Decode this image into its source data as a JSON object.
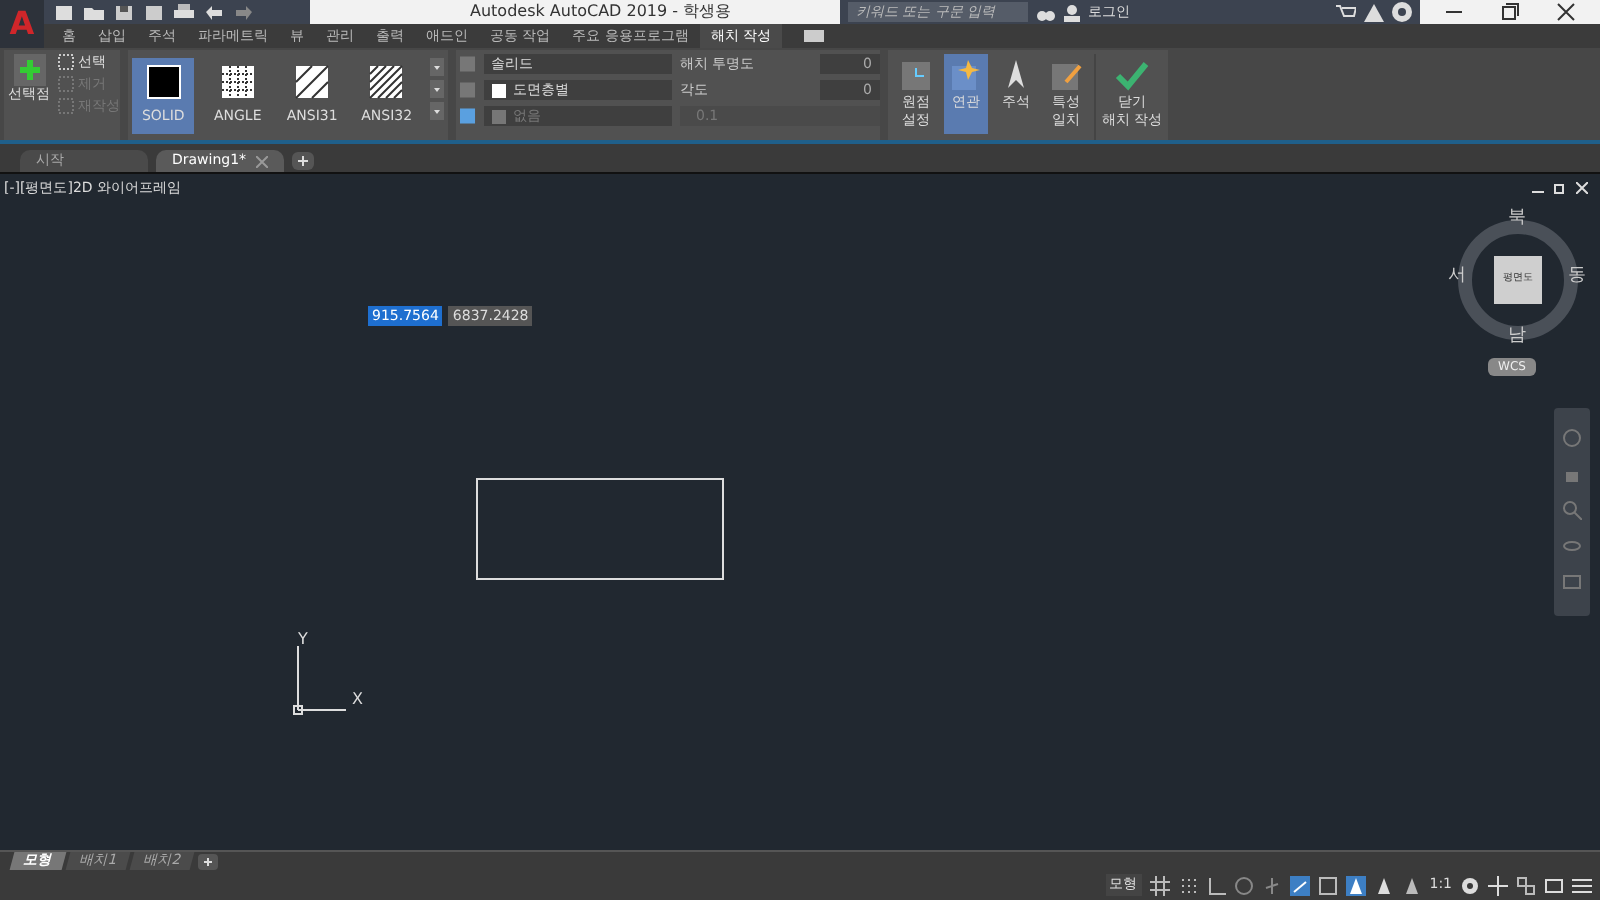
{
  "title_bar": {
    "app_button": "A",
    "title": "Autodesk AutoCAD 2019 - 학생용",
    "search_placeholder": "키워드 또는 구문 입력",
    "user": "로그인"
  },
  "ribbon_tabs": [
    {
      "label": "홈",
      "selected": false
    },
    {
      "label": "삽입",
      "selected": false
    },
    {
      "label": "주석",
      "selected": false
    },
    {
      "label": "파라메트릭",
      "selected": false
    },
    {
      "label": "뷰",
      "selected": false
    },
    {
      "label": "관리",
      "selected": false
    },
    {
      "label": "출력",
      "selected": false
    },
    {
      "label": "애드인",
      "selected": false
    },
    {
      "label": "공동 작업",
      "selected": false
    },
    {
      "label": "주요 응용프로그램",
      "selected": false
    },
    {
      "label": "해치 작성",
      "selected": true
    }
  ],
  "boundary_panel": {
    "pick_points": "선택점",
    "items": [
      {
        "label": "선택",
        "disabled": false
      },
      {
        "label": "제거",
        "disabled": true
      },
      {
        "label": "재작성",
        "disabled": true
      }
    ]
  },
  "patterns": [
    {
      "label": "SOLID",
      "kind": "solid",
      "selected": true
    },
    {
      "label": "ANGLE",
      "kind": "grid",
      "selected": false
    },
    {
      "label": "ANSI31",
      "kind": "hatch",
      "selected": false
    },
    {
      "label": "ANSI32",
      "kind": "hatch2",
      "selected": false
    }
  ],
  "properties": {
    "hatch_type": "솔리드",
    "hatch_color": "도면층별",
    "background": "없음",
    "transparency_label": "해치 투명도",
    "transparency": "0",
    "angle_label": "각도",
    "angle": "0",
    "scale": "0.1"
  },
  "tools": [
    {
      "kind": "origin",
      "lines": [
        "원점",
        "설정"
      ],
      "selected": false
    },
    {
      "kind": "associative",
      "lines": [
        "연관"
      ],
      "selected": true
    },
    {
      "kind": "annotative",
      "lines": [
        "주석"
      ],
      "selected": false
    },
    {
      "kind": "match",
      "lines": [
        "특성",
        "일치"
      ],
      "selected": false
    },
    {
      "kind": "close",
      "lines": [
        "닫기",
        "해치 작성"
      ],
      "selected": false
    }
  ],
  "file_tabs": [
    {
      "label": "시작",
      "selected": false
    },
    {
      "label": "Drawing1*",
      "selected": true
    }
  ],
  "viewport": {
    "label": "[-][평면도]2D 와이어프레임",
    "coordinates": [
      {
        "value": "915.7564",
        "selected": true
      },
      {
        "value": "6837.2428",
        "selected": false
      }
    ],
    "ucs": {
      "x": "X",
      "y": "Y"
    },
    "viewcube": {
      "north": "북",
      "south": "남",
      "east": "동",
      "west": "서",
      "face": "평면도",
      "wcs": "WCS"
    }
  },
  "layout_tabs": [
    {
      "label": "모형",
      "selected": true
    },
    {
      "label": "배치1",
      "selected": false
    },
    {
      "label": "배치2",
      "selected": false
    }
  ],
  "status_bar": {
    "model": "모형",
    "scale": "1:1"
  }
}
